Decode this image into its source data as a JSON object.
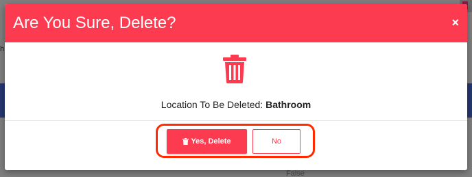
{
  "background": {
    "left_char": "h",
    "false_text": "False"
  },
  "modal": {
    "title": "Are You Sure, Delete?",
    "close_symbol": "×",
    "icon": "trash-icon",
    "message_prefix": "Location To Be Deleted:",
    "message_target": "Bathroom",
    "yes_label": "Yes, Delete",
    "no_label": "No"
  },
  "colors": {
    "accent": "#fd3b50",
    "highlight": "#ff2a00",
    "nav_background": "#26366f"
  }
}
